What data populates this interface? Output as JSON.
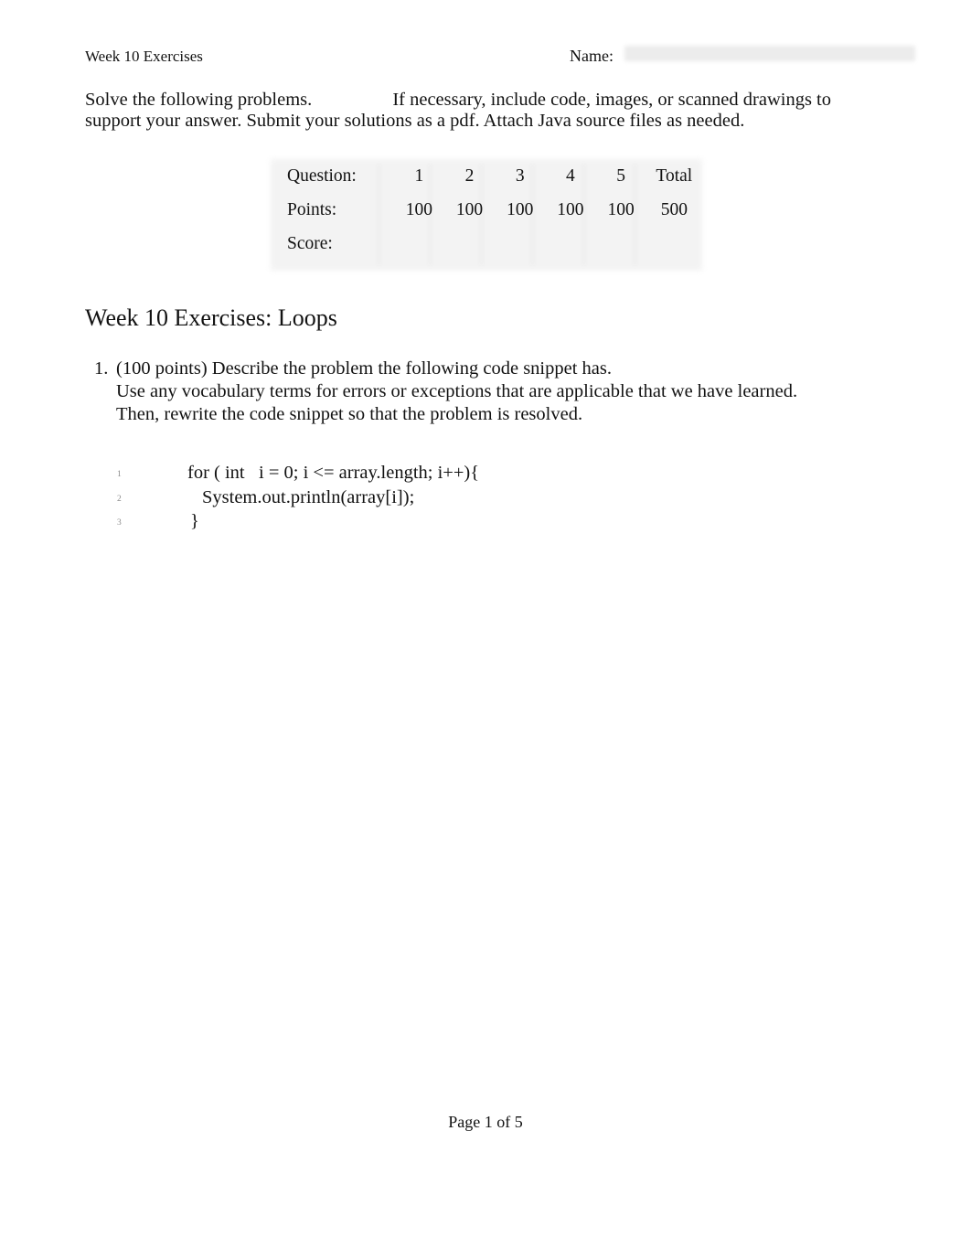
{
  "document": {
    "header": {
      "left_title": "Week 10 Exercises",
      "name_label": "Name:",
      "name_value": ""
    },
    "instructions": {
      "line1_left": "Solve the following problems.",
      "line1_right": "If necessary, include code, images, or scanned drawings to",
      "line2": "support your answer. Submit your solutions as a pdf. Attach Java source files as needed."
    },
    "grade_table": {
      "row_labels": [
        "Question:",
        "Points:",
        "Score:"
      ],
      "question_numbers": [
        "1",
        "2",
        "3",
        "4",
        "5"
      ],
      "total_header": "Total",
      "points": [
        "100",
        "100",
        "100",
        "100",
        "100"
      ],
      "total_points": "500",
      "scores": [
        "",
        "",
        "",
        "",
        ""
      ],
      "total_score": ""
    },
    "section_title": "Week 10 Exercises: Loops",
    "questions": [
      {
        "marker": "1.",
        "lines": [
          "(100 points) Describe the problem the following code snippet has.",
          "Use any vocabulary terms for errors or exceptions that are applicable that we have learned.",
          "Then, rewrite the code snippet so that the problem is resolved."
        ],
        "code_listing": [
          {
            "number": "1",
            "text": "for ( int   i = 0; i <= array.length; i++){"
          },
          {
            "number": "2",
            "text": "System.out.println(array[i]);"
          },
          {
            "number": "3",
            "text": "}"
          }
        ]
      }
    ],
    "footer": {
      "page_text": "Page 1 of 5"
    },
    "colors": {
      "page_background": "#ffffff",
      "text": "#121212",
      "table_fill": "#f1f1f1",
      "blank_fill": "#ebebeb",
      "line_number": "#8a8a8a"
    }
  }
}
